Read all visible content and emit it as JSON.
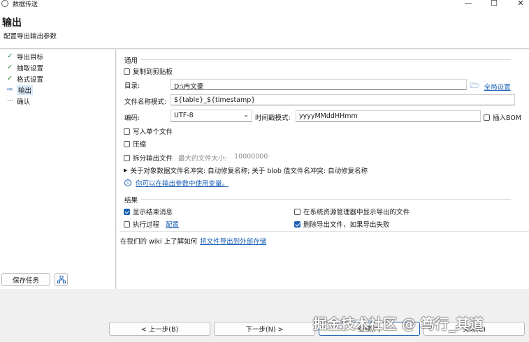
{
  "window": {
    "title": "数据传送",
    "minimize": "—",
    "maximize": "☐",
    "close": "✕"
  },
  "header": {
    "title": "输出",
    "subtitle": "配置导出输出参数"
  },
  "nav": {
    "items": [
      {
        "label": "导出目标",
        "state": "done"
      },
      {
        "label": "抽取设置",
        "state": "done"
      },
      {
        "label": "格式设置",
        "state": "done"
      },
      {
        "label": "输出",
        "state": "current"
      },
      {
        "label": "确认",
        "state": "pending"
      }
    ],
    "save_task": "保存任务"
  },
  "general": {
    "title": "通用",
    "copy_clipboard": "复制到剪贴板",
    "copy_clipboard_checked": false,
    "dir_label": "目录:",
    "dir_value": "D:\\冉文豪",
    "global_settings": "全局设置",
    "filename_label": "文件名称模式:",
    "filename_value": "${table}_${timestamp}",
    "encoding_label": "编码:",
    "encoding_value": "UTF-8",
    "timestamp_label": "时间戳模式:",
    "timestamp_value": "yyyyMMddHHmm",
    "bom_label": "插入BOM",
    "bom_checked": false,
    "single_file": "写入单个文件",
    "single_file_checked": false,
    "compress": "压缩",
    "compress_checked": false,
    "split": "拆分输出文件",
    "split_checked": false,
    "max_size_label": "最大的文件大小:",
    "max_size_value": "10000000",
    "conflict": "关于对象数据文件名冲突: 自动修复名称; 关于 blob 值文件名冲突: 自动修复名称",
    "vars_hint": "你可以在输出参数中使用变量。"
  },
  "result": {
    "title": "结果",
    "show_msg": "显示结束消息",
    "show_msg_checked": true,
    "show_in_explorer": "在系统资源管理器中显示导出的文件",
    "show_in_explorer_checked": false,
    "exec_process": "执行过程",
    "exec_process_checked": false,
    "configure": "配置",
    "delete_on_fail": "删除导出文件，如果导出失败",
    "delete_on_fail_checked": true
  },
  "wiki": {
    "prefix": "在我们的 wiki 上了解如何",
    "link": "将文件导出到外部存储"
  },
  "footer": {
    "back": "< 上一步(B)",
    "next": "下一步(N) >",
    "proceed": "继续(P)",
    "close": "关闭(C)"
  },
  "watermark": "掘金技术社区 @ 笃行_其道"
}
